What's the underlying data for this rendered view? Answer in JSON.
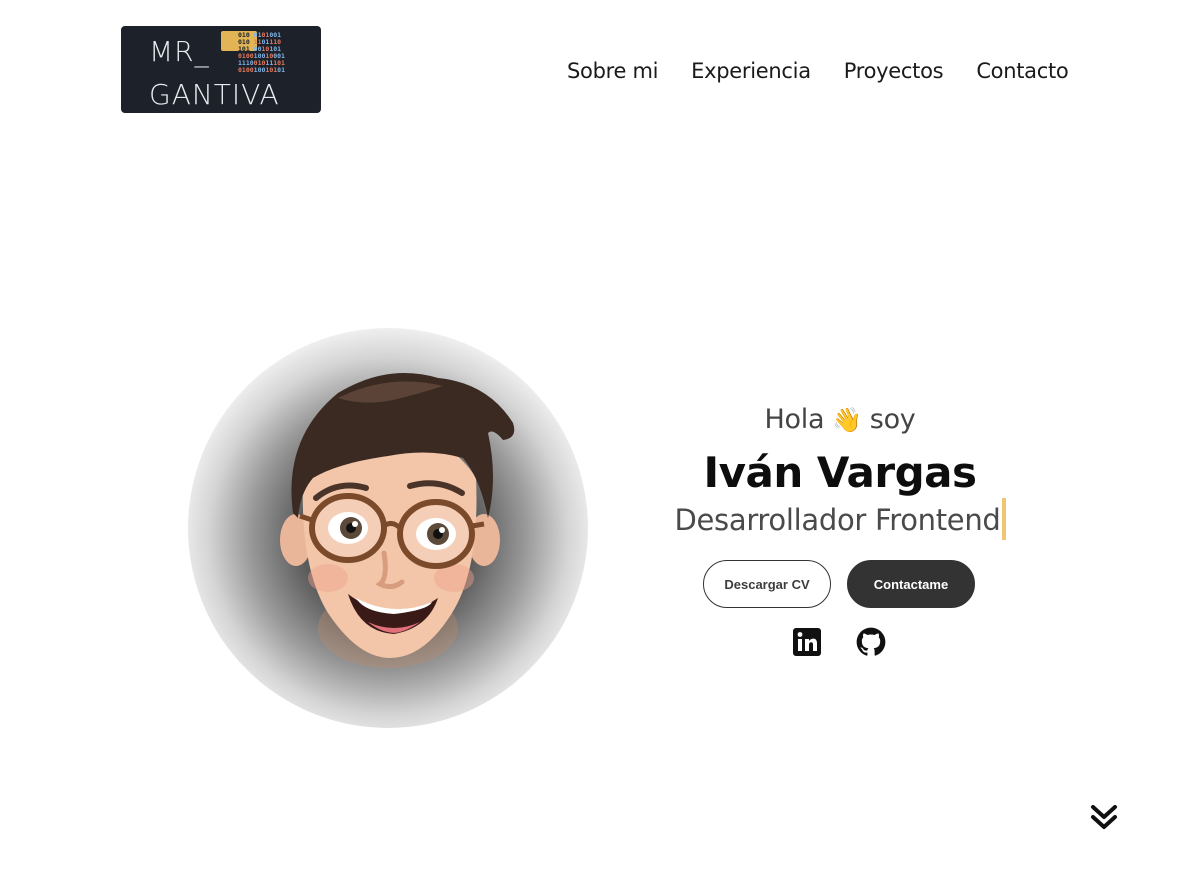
{
  "header": {
    "logo": {
      "line1": "MR_",
      "line2": "GANTIVA",
      "icon": "binary-code-logo-icon"
    },
    "nav": [
      {
        "label": "Sobre mi"
      },
      {
        "label": "Experiencia"
      },
      {
        "label": "Proyectos"
      },
      {
        "label": "Contacto"
      }
    ]
  },
  "hero": {
    "greeting_before": "Hola",
    "greeting_emoji": "👋",
    "greeting_after": "soy",
    "name": "Iván Vargas",
    "role": "Desarrollador Frontend",
    "buttons": {
      "cv": "Descargar CV",
      "contact": "Contactame"
    },
    "social": [
      {
        "icon": "linkedin-icon"
      },
      {
        "icon": "github-icon"
      }
    ],
    "avatar": "memoji-avatar"
  },
  "scroll": {
    "icon": "double-chevron-down-icon"
  },
  "colors": {
    "logo_bg": "#1d2129",
    "accent_caret": "#f0c674",
    "button_dark": "#333333",
    "text": "#111111"
  }
}
